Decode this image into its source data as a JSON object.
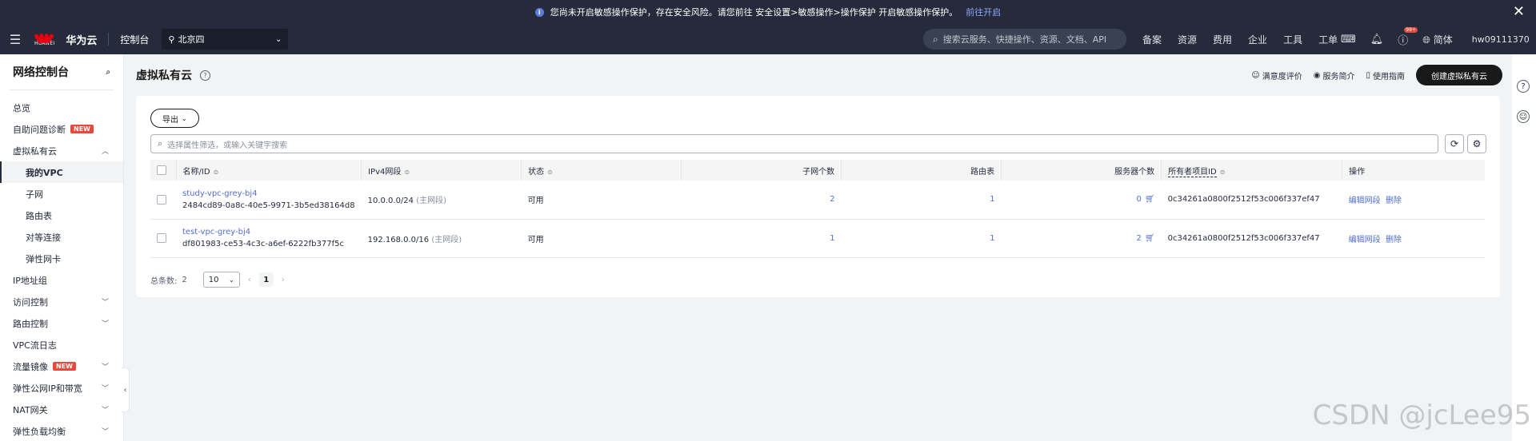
{
  "notice": {
    "text": "您尚未开启敏感操作保护，存在安全风险。请您前往 安全设置>敏感操作>操作保护 开启敏感操作保护。",
    "link": "前往开启"
  },
  "header": {
    "logo_text": "HUAWEI",
    "brand": "华为云",
    "console": "控制台",
    "region": "北京四",
    "search_placeholder": "搜索云服务、快捷操作、资源、文档、API",
    "menu": [
      "备案",
      "资源",
      "费用",
      "企业",
      "工具",
      "工单"
    ],
    "notify_badge": "99+",
    "lang": "简体",
    "user": "hw09111370"
  },
  "sidebar": {
    "title": "网络控制台",
    "items": [
      {
        "label": "总览",
        "level": 0
      },
      {
        "label": "自助问题诊断",
        "level": 0,
        "badge": "NEW"
      },
      {
        "label": "虚拟私有云",
        "level": 0,
        "chevron": "up"
      },
      {
        "label": "我的VPC",
        "level": 1,
        "active": true
      },
      {
        "label": "子网",
        "level": 1
      },
      {
        "label": "路由表",
        "level": 1
      },
      {
        "label": "对等连接",
        "level": 1
      },
      {
        "label": "弹性网卡",
        "level": 1
      },
      {
        "label": "IP地址组",
        "level": 0
      },
      {
        "label": "访问控制",
        "level": 0,
        "chevron": "down"
      },
      {
        "label": "路由控制",
        "level": 0,
        "chevron": "down"
      },
      {
        "label": "VPC流日志",
        "level": 0
      },
      {
        "label": "流量镜像",
        "level": 0,
        "badge": "NEW",
        "chevron": "down"
      },
      {
        "label": "弹性公网IP和带宽",
        "level": 0,
        "chevron": "down"
      },
      {
        "label": "NAT网关",
        "level": 0,
        "chevron": "down"
      },
      {
        "label": "弹性负载均衡",
        "level": 0,
        "chevron": "down"
      }
    ]
  },
  "page": {
    "title": "虚拟私有云",
    "actions": [
      "满意度评价",
      "服务简介",
      "使用指南"
    ],
    "create_label": "创建虚拟私有云"
  },
  "toolbar": {
    "export_label": "导出",
    "filter_placeholder": "选择属性筛选，或输入关键字搜索"
  },
  "table": {
    "columns": [
      "名称/ID",
      "IPv4网段",
      "状态",
      "子网个数",
      "路由表",
      "服务器个数",
      "所有者项目ID",
      "操作"
    ],
    "rows": [
      {
        "name": "study-vpc-grey-bj4",
        "id": "2484cd89-0a8c-40e5-9971-3b5ed38164d8",
        "cidr": "10.0.0.0/24",
        "cidr_note": "(主网段)",
        "status": "可用",
        "subnets": "2",
        "route_tables": "1",
        "servers": "0",
        "owner": "0c34261a0800f2512f53c006f337ef47",
        "op_edit": "编辑网段",
        "op_delete": "删除"
      },
      {
        "name": "test-vpc-grey-bj4",
        "id": "df801983-ce53-4c3c-a6ef-6222fb377f5c",
        "cidr": "192.168.0.0/16",
        "cidr_note": "(主网段)",
        "status": "可用",
        "subnets": "1",
        "route_tables": "1",
        "servers": "2",
        "owner": "0c34261a0800f2512f53c006f337ef47",
        "op_edit": "编辑网段",
        "op_delete": "删除"
      }
    ]
  },
  "pager": {
    "total_label": "总条数:",
    "total": "2",
    "page_size": "10",
    "current_page": "1"
  },
  "watermark": "CSDN @jcLee95"
}
